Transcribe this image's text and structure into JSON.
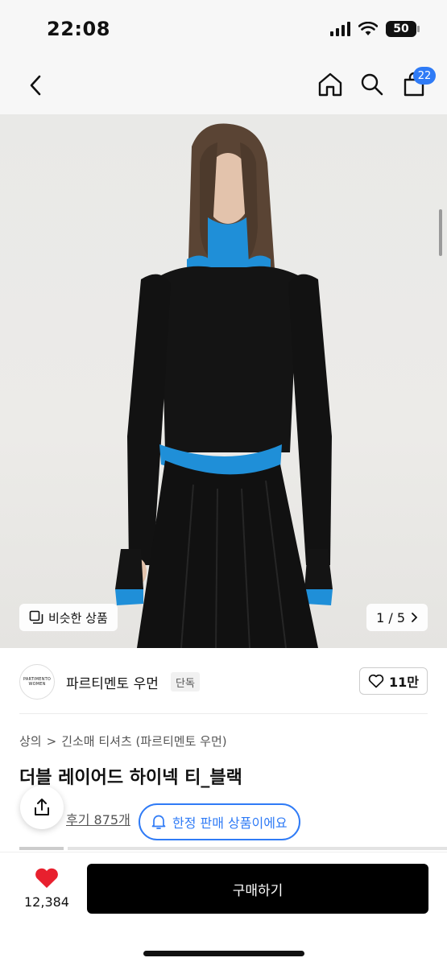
{
  "status": {
    "time": "22:08",
    "battery": "50"
  },
  "nav": {
    "cart_count": "22"
  },
  "hero": {
    "similar_label": "비슷한 상품",
    "counter": "1 / 5"
  },
  "brand": {
    "name": "파르티멘토 우먼",
    "logo_line1": "PARTIMENTO",
    "logo_line2": "WOMEN",
    "exclusive": "단독",
    "likes": "11만"
  },
  "breadcrumb": {
    "level1": "상의",
    "separator": ">",
    "level2": "긴소매 티셔츠 (파르티멘토 우먼)"
  },
  "product": {
    "title": "더블 레이어드 하이넥 티_블랙",
    "reviews": "후기 875개",
    "limited_label": "한정 판매 상품이에요"
  },
  "bottom": {
    "wish_count": "12,384",
    "buy_label": "구매하기"
  },
  "colors": {
    "accent_blue": "#2f7bf6",
    "heart_red": "#e8202e",
    "buy_button": "#000000"
  }
}
